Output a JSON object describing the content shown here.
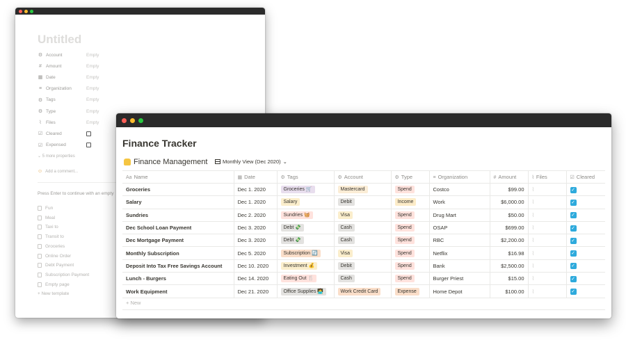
{
  "back_window": {
    "title": "Untitled",
    "properties": [
      {
        "icon": "⚙",
        "icon_name": "gear-icon",
        "label": "Account",
        "value": "Empty"
      },
      {
        "icon": "#",
        "icon_name": "hash-icon",
        "label": "Amount",
        "value": "Empty"
      },
      {
        "icon": "▦",
        "icon_name": "calendar-icon",
        "label": "Date",
        "value": "Empty"
      },
      {
        "icon": "≡",
        "icon_name": "text-icon",
        "label": "Organization",
        "value": "Empty"
      },
      {
        "icon": "⚙",
        "icon_name": "gear-icon",
        "label": "Tags",
        "value": "Empty"
      },
      {
        "icon": "⚙",
        "icon_name": "gear-icon",
        "label": "Type",
        "value": "Empty"
      },
      {
        "icon": "⌇",
        "icon_name": "paperclip-icon",
        "label": "Files",
        "value": "Empty"
      },
      {
        "icon": "☑",
        "icon_name": "checkbox-icon",
        "label": "Cleared",
        "value": ""
      },
      {
        "icon": "☑",
        "icon_name": "checkbox-icon",
        "label": "Expensed",
        "value": ""
      }
    ],
    "more_properties": "5 more properties",
    "add_comment": "Add a comment...",
    "press_enter": "Press Enter to continue with an empty",
    "templates": [
      "Fun",
      "Meal",
      "Taxi to",
      "Transit to",
      "Groceries",
      "Online Order",
      "Debt Payment",
      "Subscription Payment",
      "Empty page"
    ],
    "new_template": "+ New template"
  },
  "front_window": {
    "title": "Finance Tracker",
    "database_title": "Finance Management",
    "view_selector": "Monthly View (Dec 2020)",
    "columns": [
      {
        "icon": "Aa",
        "label": "Name"
      },
      {
        "icon": "▦",
        "label": "Date"
      },
      {
        "icon": "⚙",
        "label": "Tags"
      },
      {
        "icon": "⚙",
        "label": "Account"
      },
      {
        "icon": "⚙",
        "label": "Type"
      },
      {
        "icon": "≡",
        "label": "Organization"
      },
      {
        "icon": "#",
        "label": "Amount"
      },
      {
        "icon": "⌇",
        "label": "Files"
      },
      {
        "icon": "☑",
        "label": "Cleared"
      }
    ],
    "rows": [
      {
        "name": "Groceries",
        "date": "Dec 1. 2020",
        "tag": "Groceries 🛒",
        "tag_color": "#e8deee",
        "account": "Mastercard",
        "account_color": "#fbedd6",
        "type": "Spend",
        "type_color": "#ffe2dd",
        "org": "Costco",
        "amount": "$99.00"
      },
      {
        "name": "Salary",
        "date": "Dec 1. 2020",
        "tag": "Salary",
        "tag_color": "#fbeecc",
        "account": "Debit",
        "account_color": "#e3e2e0",
        "type": "Income",
        "type_color": "#fdecc8",
        "org": "Work",
        "amount": "$6,000.00"
      },
      {
        "name": "Sundries",
        "date": "Dec 2. 2020",
        "tag": "Sundries 🧺",
        "tag_color": "#ffe2dd",
        "account": "Visa",
        "account_color": "#fbeecc",
        "type": "Spend",
        "type_color": "#ffe2dd",
        "org": "Drug Mart",
        "amount": "$50.00"
      },
      {
        "name": "Dec School Loan Payment",
        "date": "Dec 3. 2020",
        "tag": "Debt 💸",
        "tag_color": "#e3e2e0",
        "account": "Cash",
        "account_color": "#e3e2e0",
        "type": "Spend",
        "type_color": "#ffe2dd",
        "org": "OSAP",
        "amount": "$699.00"
      },
      {
        "name": "Dec Mortgage Payment",
        "date": "Dec 3. 2020",
        "tag": "Debt 💸",
        "tag_color": "#e3e2e0",
        "account": "Cash",
        "account_color": "#e3e2e0",
        "type": "Spend",
        "type_color": "#ffe2dd",
        "org": "RBC",
        "amount": "$2,200.00"
      },
      {
        "name": "Monthly Subscription",
        "date": "Dec 5. 2020",
        "tag": "Subscription 🔄",
        "tag_color": "#fadec9",
        "account": "Visa",
        "account_color": "#fbeecc",
        "type": "Spend",
        "type_color": "#ffe2dd",
        "org": "Netflix",
        "amount": "$16.98"
      },
      {
        "name": "Deposit Into Tax Free Savings Account",
        "date": "Dec 10. 2020",
        "tag": "Investment 💰",
        "tag_color": "#fbeecc",
        "account": "Debit",
        "account_color": "#e3e2e0",
        "type": "Spend",
        "type_color": "#ffe2dd",
        "org": "Bank",
        "amount": "$2,500.00"
      },
      {
        "name": "Lunch - Burgers",
        "date": "Dec 14. 2020",
        "tag": "Eating Out 🍴",
        "tag_color": "#ffe2dd",
        "account": "Cash",
        "account_color": "#e3e2e0",
        "type": "Spend",
        "type_color": "#ffe2dd",
        "org": "Burger Priest",
        "amount": "$15.00"
      },
      {
        "name": "Work Equipment",
        "date": "Dec 21. 2020",
        "tag": "Office Supplies 🧑‍💻",
        "tag_color": "#e3e2e0",
        "account": "Work Credit Card",
        "account_color": "#fadec9",
        "type": "Expense",
        "type_color": "#fadec9",
        "org": "Home Depot",
        "amount": "$100.00"
      }
    ],
    "new_label": "+ New"
  }
}
